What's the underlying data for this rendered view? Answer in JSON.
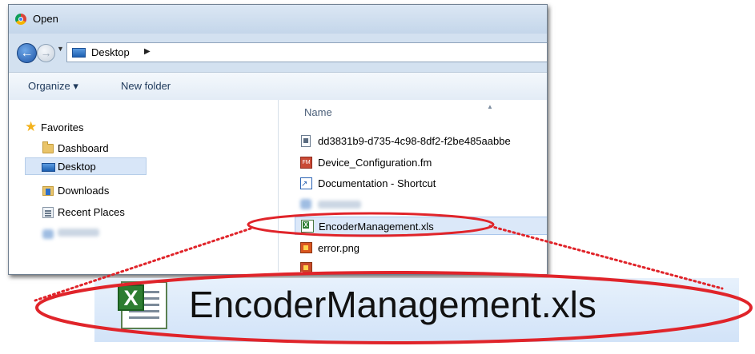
{
  "window": {
    "title": "Open",
    "icon": "chrome-icon"
  },
  "navbar": {
    "back_icon": "back-arrow-icon",
    "forward_icon": "forward-arrow-icon",
    "address_path": [
      "Desktop"
    ],
    "address_icon": "desktop-icon"
  },
  "toolbar": {
    "organize_label": "Organize ▾",
    "new_folder_label": "New folder"
  },
  "nav_pane": {
    "favorites_label": "Favorites",
    "items": [
      {
        "label": "Dashboard",
        "icon": "folder-icon"
      },
      {
        "label": "Desktop",
        "icon": "desktop-icon",
        "selected": true
      },
      {
        "label": "Downloads",
        "icon": "downloads-icon"
      },
      {
        "label": "Recent Places",
        "icon": "recent-places-icon"
      }
    ]
  },
  "file_pane": {
    "column_header": "Name",
    "files": [
      {
        "label": "dd3831b9-d735-4c98-8df2-f2be485aabbe",
        "icon": "document-icon"
      },
      {
        "label": "Device_Configuration.fm",
        "icon": "fm-file-icon"
      },
      {
        "label": "Documentation - Shortcut",
        "icon": "shortcut-icon"
      },
      {
        "label": "EncoderManagement.xls",
        "icon": "excel-file-icon",
        "selected": true
      },
      {
        "label": "error.png",
        "icon": "png-file-icon"
      }
    ]
  },
  "callout": {
    "zoom_label": "EncoderManagement.xls",
    "highlight_color": "#e0242a"
  }
}
